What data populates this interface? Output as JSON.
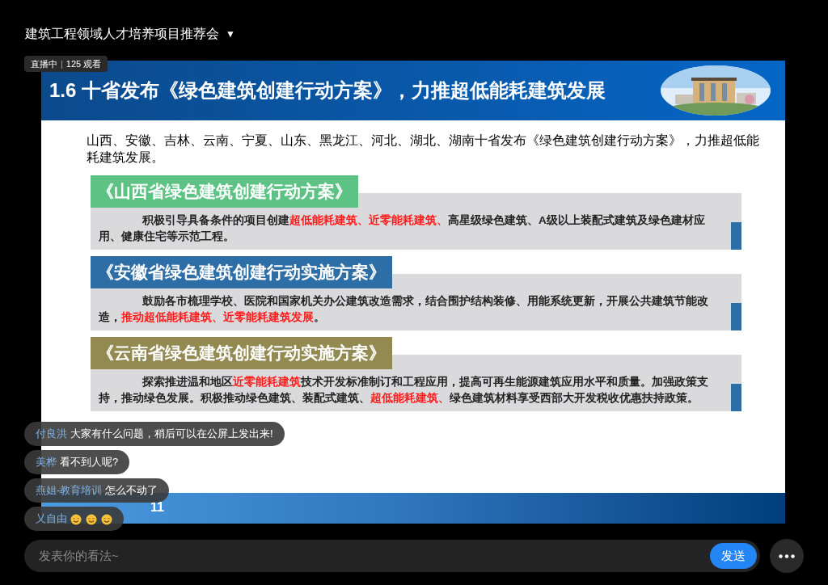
{
  "title": "建筑工程领域人才培养项目推荐会",
  "title_caret": "▼",
  "live_badge": {
    "status": "直播中",
    "separator": "|",
    "viewers": "125 观看"
  },
  "slide": {
    "heading": "1.6 十省发布《绿色建筑创建行动方案》，力推超低能耗建筑发展",
    "intro": "山西、安徽、吉林、云南、宁夏、山东、黑龙江、河北、湖北、湖南十省发布《绿色建筑创建行动方案》，力推超低能耗建筑发展。",
    "sections": [
      {
        "label": "《山西省绿色建筑创建行动方案》",
        "color": "#5cc384",
        "segments": [
          {
            "text": "积极引导具备条件的项目创建",
            "highlight": false
          },
          {
            "text": "超低能耗建筑、近零能耗建筑、",
            "highlight": true
          },
          {
            "text": "高星级绿色建筑、A级以上装配式建筑及绿色建材应用、健康住宅等示范工程。",
            "highlight": false
          }
        ]
      },
      {
        "label": "《安徽省绿色建筑创建行动实施方案》",
        "color": "#2e6ea6",
        "segments": [
          {
            "text": "鼓励各市梳理学校、医院和国家机关办公建筑改造需求，结合围护结构装修、用能系统更新，开展公共建筑节能改造，",
            "highlight": false
          },
          {
            "text": "推动超低能耗建筑、近零能耗建筑发展",
            "highlight": true
          },
          {
            "text": "。",
            "highlight": false
          }
        ]
      },
      {
        "label": "《云南省绿色建筑创建行动实施方案》",
        "color": "#938a52",
        "segments": [
          {
            "text": "探索推进温和地区",
            "highlight": false
          },
          {
            "text": "近零能耗建筑",
            "highlight": true
          },
          {
            "text": "技术开发标准制订和工程应用，提高可再生能源建筑应用水平和质量。加强政策支持，推动绿色发展。积极推动绿色建筑、装配式建筑、",
            "highlight": false
          },
          {
            "text": "超低能耗建筑、",
            "highlight": true
          },
          {
            "text": "绿色建筑材料享受西部大开发税收优惠扶持政策。",
            "highlight": false
          }
        ]
      }
    ],
    "page_number": "11"
  },
  "chat": [
    {
      "name": "付良洪",
      "text": "大家有什么问题，稍后可以在公屏上发出来!"
    },
    {
      "name": "美桦",
      "text": "看不到人呢?"
    },
    {
      "name": "燕姐-教育培训",
      "text": "怎么不动了"
    },
    {
      "name": "乂自由",
      "emojis": [
        {
          "kind": "smile"
        },
        {
          "kind": "smile"
        },
        {
          "kind": "smile"
        }
      ]
    }
  ],
  "comment_box": {
    "placeholder": "发表你的看法~",
    "send": "发送"
  }
}
